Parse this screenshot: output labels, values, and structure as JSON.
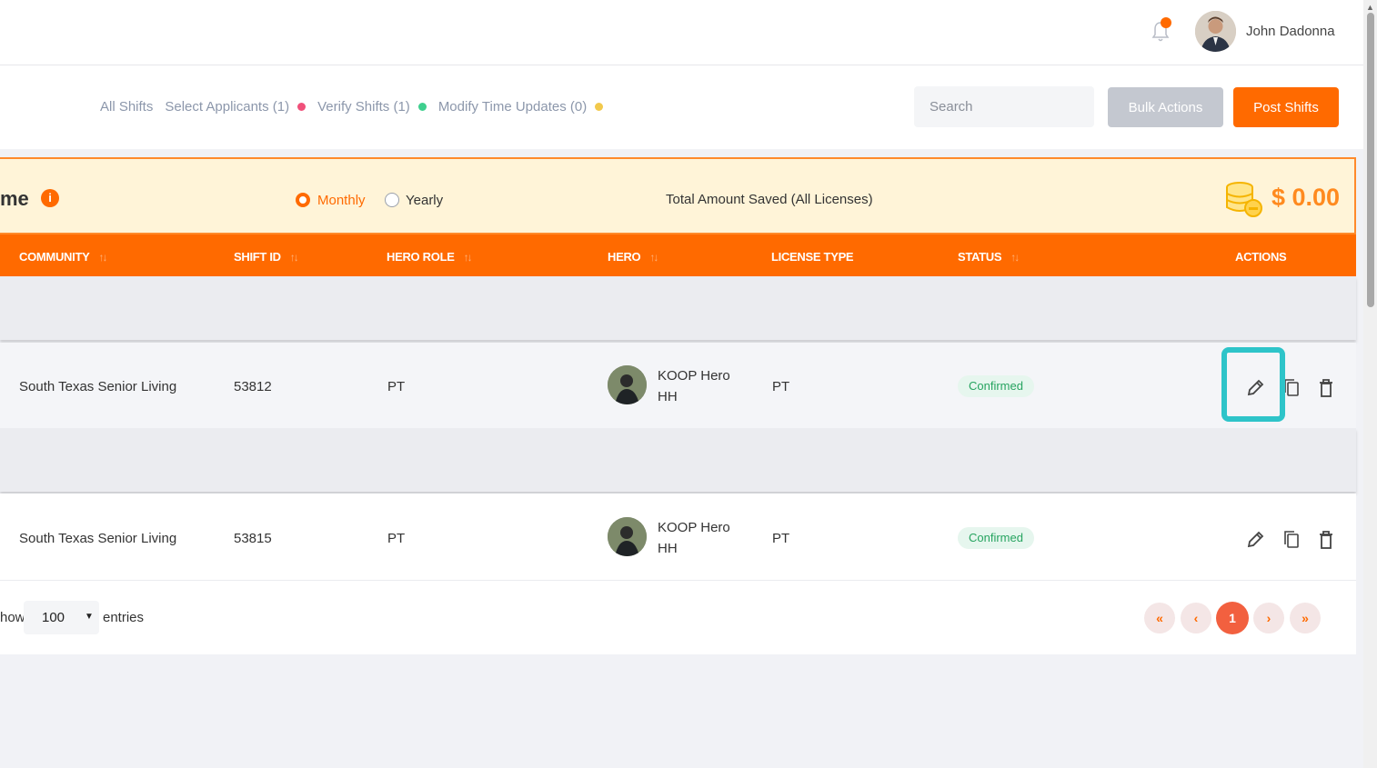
{
  "header": {
    "user_name": "John Dadonna",
    "notification_indicator": true
  },
  "tabs": [
    {
      "label": "All Shifts",
      "dot_color": null
    },
    {
      "label": "Select Applicants (1)",
      "dot_color": "#f0507a"
    },
    {
      "label": "Verify Shifts (1)",
      "dot_color": "#3ecf8e"
    },
    {
      "label": "Modify Time Updates (0)",
      "dot_color": "#f2c94c"
    }
  ],
  "search": {
    "placeholder": "Search"
  },
  "buttons": {
    "bulk_actions": "Bulk Actions",
    "post_shifts": "Post Shifts"
  },
  "banner": {
    "title_partial": "me",
    "options": {
      "monthly": "Monthly",
      "yearly": "Yearly"
    },
    "selected": "Monthly",
    "total_label": "Total Amount Saved (All Licenses)",
    "total_value": "$ 0.00"
  },
  "table": {
    "columns": {
      "community": "COMMUNITY",
      "shift_id": "SHIFT ID",
      "hero_role": "HERO ROLE",
      "hero": "HERO",
      "license_type": "LICENSE TYPE",
      "status": "STATUS",
      "actions": "ACTIONS"
    },
    "rows": [
      {
        "community": "South Texas Senior Living",
        "shift_id": "53812",
        "hero_role": "PT",
        "hero_line1": "KOOP Hero",
        "hero_line2": "HH",
        "license_type": "PT",
        "status": "Confirmed"
      },
      {
        "community": "South Texas Senior Living",
        "shift_id": "53815",
        "hero_role": "PT",
        "hero_line1": "KOOP Hero",
        "hero_line2": "HH",
        "license_type": "PT",
        "status": "Confirmed"
      }
    ]
  },
  "footer": {
    "show_label": "how",
    "entries_value": "100",
    "entries_label": "entries",
    "current_page": "1"
  },
  "colors": {
    "accent": "#ff6a00",
    "highlight": "#2ec4c9",
    "confirmed": "#27a460"
  }
}
